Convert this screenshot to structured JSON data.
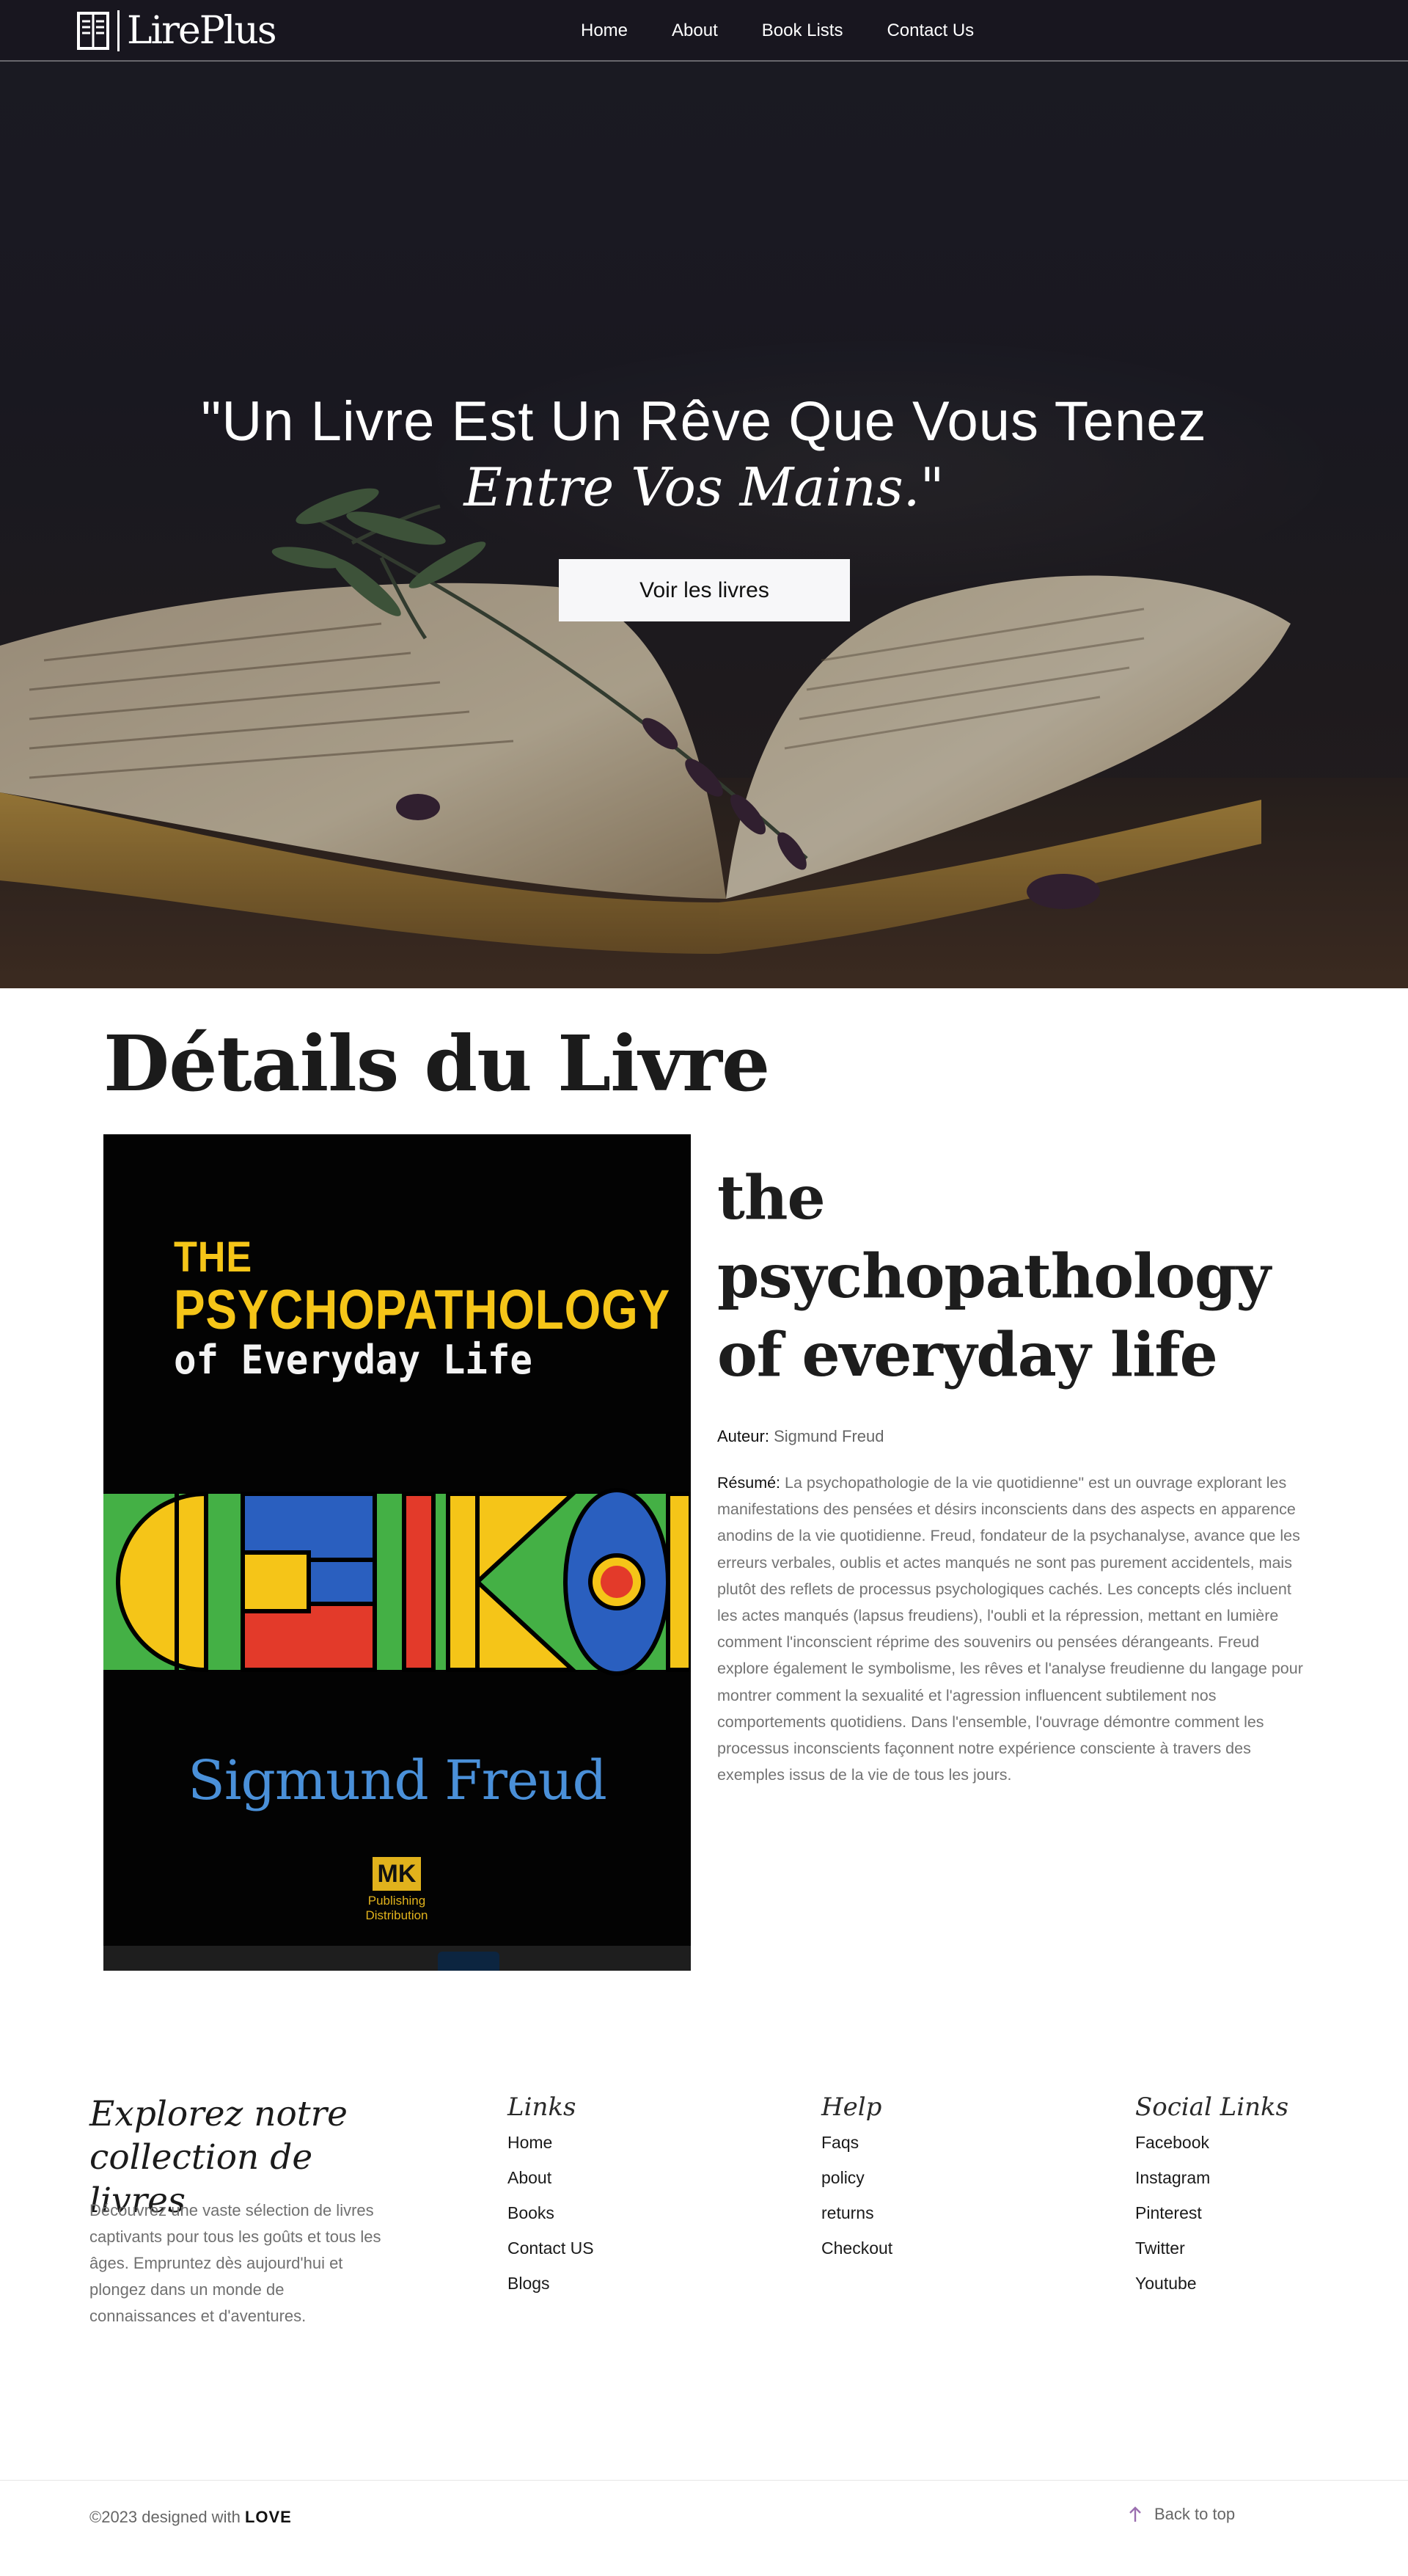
{
  "nav": {
    "brand": "LirePlus",
    "links": [
      "Home",
      "About",
      "Book Lists",
      "Contact Us"
    ]
  },
  "hero": {
    "line1": "\"Un Livre Est Un Rêve Que Vous Tenez",
    "line2": "Entre Vos Mains.\"",
    "button": "Voir les livres"
  },
  "details": {
    "heading": "Détails du Livre",
    "title": "the psychopathology of everyday life",
    "author_label": "Auteur:",
    "author": "Sigmund Freud",
    "summary_label": "Résumé:",
    "summary": "La psychopathologie de la vie quotidienne\" est un ouvrage explorant les manifestations des pensées et désirs inconscients dans des aspects en apparence anodins de la vie quotidienne. Freud, fondateur de la psychanalyse, avance que les erreurs verbales, oublis et actes manqués ne sont pas purement accidentels, mais plutôt des reflets de processus psychologiques cachés. Les concepts clés incluent les actes manqués (lapsus freudiens), l'oubli et la répression, mettant en lumière comment l'inconscient réprime des souvenirs ou pensées dérangeants. Freud explore également le symbolisme, les rêves et l'analyse freudienne du langage pour montrer comment la sexualité et l'agression influencent subtilement nos comportements quotidiens. Dans l'ensemble, l'ouvrage démontre comment les processus inconscients façonnent notre expérience consciente à travers des exemples issus de la vie de tous les jours.",
    "cover": {
      "line1": "THE",
      "line2": "PSYCHOPATHOLOGY",
      "line3": "of Everyday Life",
      "author": "Sigmund Freud",
      "publisher_mark": "MK",
      "publisher_line1": "Publishing",
      "publisher_line2": "Distribution"
    }
  },
  "footer": {
    "brand_line1": "Explorez notre",
    "brand_line2": "collection de livres",
    "description": "Découvrez une vaste sélection de livres captivants pour tous les goûts et tous les âges. Empruntez dès aujourd'hui et plongez dans un monde de connaissances et d'aventures.",
    "columns": [
      {
        "title": "Links",
        "items": [
          "Home",
          "About",
          "Books",
          "Contact US",
          "Blogs"
        ]
      },
      {
        "title": "Help",
        "items": [
          "Faqs",
          "policy",
          "returns",
          "Checkout"
        ]
      },
      {
        "title": "Social Links",
        "items": [
          "Facebook",
          "Instagram",
          "Pinterest",
          "Twitter",
          "Youtube"
        ]
      }
    ],
    "copyright": "©2023 designed with",
    "copyright_brand": "LOVE",
    "back_to_top": "Back to top"
  },
  "icons": {
    "logo": "open-book-icon",
    "back_to_top": "arrow-up-icon"
  },
  "colors": {
    "hero_overlay": "#1b1a22",
    "button_bg": "#f7f7f9",
    "muted_text": "#737373",
    "arrow_accent": "#9b6fb0"
  }
}
